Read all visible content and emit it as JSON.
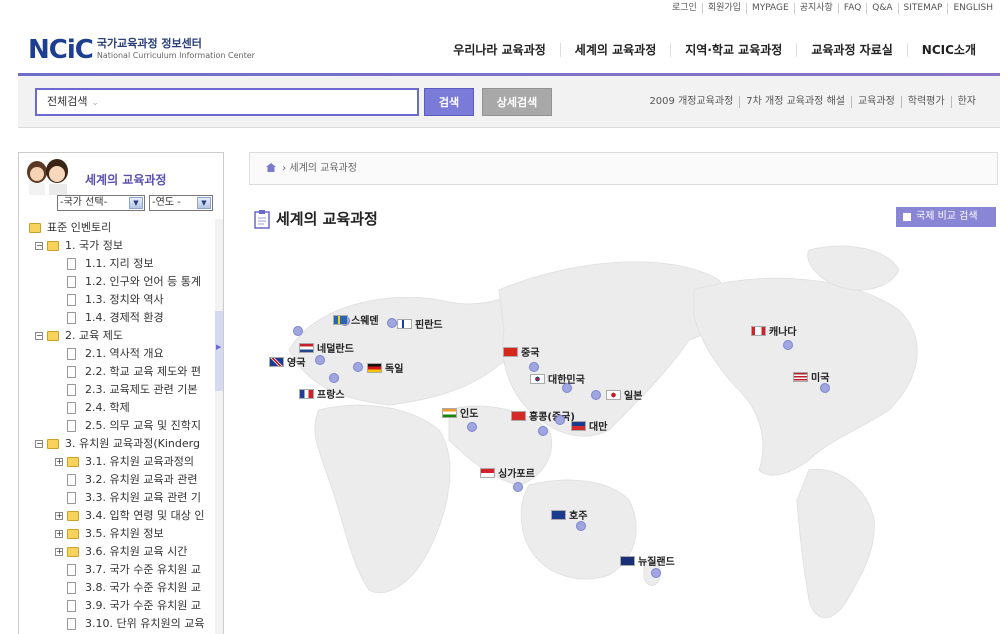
{
  "util_links": [
    "로그인",
    "회원가입",
    "MYPAGE",
    "공지사항",
    "FAQ",
    "Q&A",
    "SITEMAP",
    "ENGLISH"
  ],
  "logo": {
    "mark": "NCiC",
    "ko": "국가교육과정 정보센터",
    "en": "National Curriculum Information Center"
  },
  "gnb": [
    "우리나라 교육과정",
    "세계의 교육과정",
    "지역·학교 교육과정",
    "교육과정 자료실",
    "NCIC소개"
  ],
  "search": {
    "scope": "전체검색",
    "chevron": "⌄",
    "search_label": "검색",
    "detail_label": "상세검색"
  },
  "search_links": [
    "2009 개정교육과정",
    "7차 개정 교육과정 해설",
    "교육과정",
    "학력평가",
    "한자"
  ],
  "left_menu": {
    "title": "세계의 교육과정",
    "country_select": "-국가 선택-",
    "year_select": "-연도 -",
    "tree": [
      {
        "label": "표준 인벤토리",
        "level": 0,
        "type": "folder",
        "toggle": ""
      },
      {
        "label": "1. 국가 정보",
        "level": 1,
        "type": "folder",
        "toggle": "−"
      },
      {
        "label": "1.1. 지리 정보",
        "level": 2,
        "type": "doc",
        "toggle": ""
      },
      {
        "label": "1.2. 인구와 언어 등 통계",
        "level": 2,
        "type": "doc",
        "toggle": ""
      },
      {
        "label": "1.3. 정치와 역사",
        "level": 2,
        "type": "doc",
        "toggle": ""
      },
      {
        "label": "1.4. 경제적 환경",
        "level": 2,
        "type": "doc",
        "toggle": ""
      },
      {
        "label": "2. 교육 제도",
        "level": 1,
        "type": "folder",
        "toggle": "−"
      },
      {
        "label": "2.1. 역사적 개요",
        "level": 2,
        "type": "doc",
        "toggle": ""
      },
      {
        "label": "2.2. 학교 교육 제도와 편",
        "level": 2,
        "type": "doc",
        "toggle": ""
      },
      {
        "label": "2.3. 교육제도 관련 기본",
        "level": 2,
        "type": "doc",
        "toggle": ""
      },
      {
        "label": "2.4. 학제",
        "level": 2,
        "type": "doc",
        "toggle": ""
      },
      {
        "label": "2.5. 의무 교육 및 진학지",
        "level": 2,
        "type": "doc",
        "toggle": ""
      },
      {
        "label": "3. 유치원 교육과정(Kinderg",
        "level": 1,
        "type": "folder",
        "toggle": "−"
      },
      {
        "label": "3.1. 유치원 교육과정의",
        "level": 2,
        "type": "folder",
        "toggle": "+"
      },
      {
        "label": "3.2. 유치원 교육과 관련",
        "level": 2,
        "type": "doc",
        "toggle": ""
      },
      {
        "label": "3.3. 유치원 교육 관련 기",
        "level": 2,
        "type": "doc",
        "toggle": ""
      },
      {
        "label": "3.4. 입학 연령 및 대상 인",
        "level": 2,
        "type": "folder",
        "toggle": "+"
      },
      {
        "label": "3.5. 유치원 정보",
        "level": 2,
        "type": "folder",
        "toggle": "+"
      },
      {
        "label": "3.6. 유치원 교육 시간",
        "level": 2,
        "type": "folder",
        "toggle": "+"
      },
      {
        "label": "3.7. 국가 수준 유치원 교",
        "level": 2,
        "type": "doc",
        "toggle": ""
      },
      {
        "label": "3.8. 국가 수준 유치원 교",
        "level": 2,
        "type": "doc",
        "toggle": ""
      },
      {
        "label": "3.9. 국가 수준 유치원 교",
        "level": 2,
        "type": "doc",
        "toggle": ""
      },
      {
        "label": "3.10. 단위 유치원의 교육",
        "level": 2,
        "type": "doc",
        "toggle": ""
      }
    ]
  },
  "breadcrumb": {
    "current": "세계의 교육과정"
  },
  "page_title": "세계의 교육과정",
  "compare_button": "국제 비교 검색",
  "countries": [
    {
      "id": "sweden",
      "label": "스웨덴",
      "flag": "sweden"
    },
    {
      "id": "finland",
      "label": "핀란드",
      "flag": "finland"
    },
    {
      "id": "netherlands",
      "label": "네덜란드",
      "flag": "netherlands"
    },
    {
      "id": "uk",
      "label": "영국",
      "flag": "uk"
    },
    {
      "id": "germany",
      "label": "독일",
      "flag": "germany"
    },
    {
      "id": "france",
      "label": "프랑스",
      "flag": "france"
    },
    {
      "id": "china",
      "label": "중국",
      "flag": "china"
    },
    {
      "id": "korea",
      "label": "대한민국",
      "flag": "korea"
    },
    {
      "id": "japan",
      "label": "일본",
      "flag": "japan"
    },
    {
      "id": "india",
      "label": "인도",
      "flag": "india"
    },
    {
      "id": "hongkong",
      "label": "홍콩(중국)",
      "flag": "hongkong"
    },
    {
      "id": "taiwan",
      "label": "대만",
      "flag": "taiwan"
    },
    {
      "id": "singapore",
      "label": "싱가포르",
      "flag": "singapore"
    },
    {
      "id": "australia",
      "label": "호주",
      "flag": "australia"
    },
    {
      "id": "newzealand",
      "label": "뉴질랜드",
      "flag": "newzealand"
    },
    {
      "id": "canada",
      "label": "캐나다",
      "flag": "canada"
    },
    {
      "id": "usa",
      "label": "미국",
      "flag": "usa"
    }
  ],
  "colors": {
    "accent": "#6e6ec8",
    "search_button": "#7a7ad8",
    "detail_button": "#a8a8a8",
    "map_land": "#ededed",
    "marker": "#9fa6e0"
  }
}
